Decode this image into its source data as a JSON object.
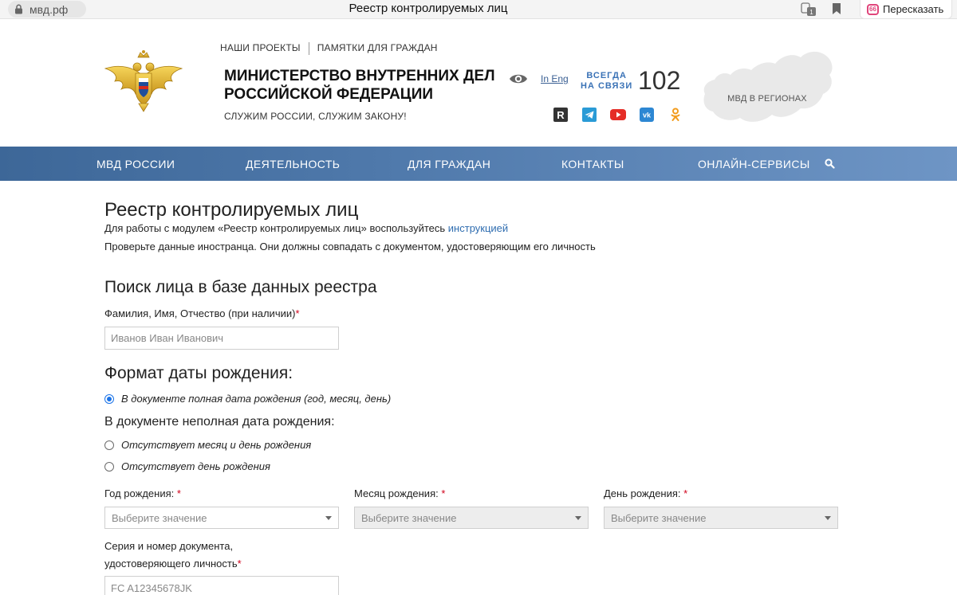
{
  "browser": {
    "url": "мвд.рф",
    "tab_title": "Реестр контролируемых лиц",
    "retell_label": "Пересказать",
    "retell_icon_text": "66",
    "badge_count": "1"
  },
  "header": {
    "top_links": [
      "НАШИ ПРОЕКТЫ",
      "ПАМЯТКИ ДЛЯ ГРАЖДАН"
    ],
    "org_name_line1": "МИНИСТЕРСТВО ВНУТРЕННИХ ДЕЛ",
    "org_name_line2": "РОССИЙСКОЙ ФЕДЕРАЦИИ",
    "motto": "СЛУЖИМ РОССИИ, СЛУЖИМ ЗАКОНУ!",
    "lang_link": "In Eng",
    "always_line1": "ВСЕГДА",
    "always_line2": "НА СВЯЗИ",
    "hotline": "102",
    "regions_label": "МВД В РЕГИОНАХ",
    "socials": [
      "rutube-icon",
      "telegram-icon",
      "youtube-icon",
      "vk-icon",
      "odnoklassniki-icon"
    ],
    "social_letters": {
      "rutube": "R",
      "vk": "vk"
    }
  },
  "nav": {
    "items": [
      "МВД РОССИИ",
      "ДЕЯТЕЛЬНОСТЬ",
      "ДЛЯ ГРАЖДАН",
      "КОНТАКТЫ",
      "ОНЛАЙН-СЕРВИСЫ"
    ]
  },
  "content": {
    "title": "Реестр контролируемых лиц",
    "intro_prefix": "Для работы с модулем «Реестр контролируемых лиц» воспользуйтесь ",
    "intro_link": "инструкцией",
    "intro_line2": "Проверьте данные иностранца. Они должны совпадать с документом, удостоверяющим его личность",
    "search_heading": "Поиск лица в базе данных реестра",
    "fio_label": "Фамилия, Имя, Отчество (при наличии)",
    "fio_placeholder": "Иванов Иван Иванович",
    "required_mark": "*",
    "dob_heading": "Формат даты рождения:",
    "dob_full": "В документе полная дата рождения (год, месяц, день)",
    "dob_partial_label": "В документе неполная дата рождения:",
    "dob_no_month_day": "Отсутствует месяц и день рождения",
    "dob_no_day": "Отсутствует день рождения",
    "year_label": "Год рождения:",
    "month_label": "Месяц рождения:",
    "day_label": "День рождения:",
    "select_placeholder": "Выберите значение",
    "doc_label_line1": "Серия и номер документа,",
    "doc_label_line2": "удостоверяющего личность",
    "doc_value": "FC A12345678JK"
  },
  "colors": {
    "nav_start": "#3d6798",
    "nav_end": "#6e95c5",
    "link": "#2f6db0",
    "required": "#d0021b",
    "accent_blue": "#3a72b6"
  }
}
